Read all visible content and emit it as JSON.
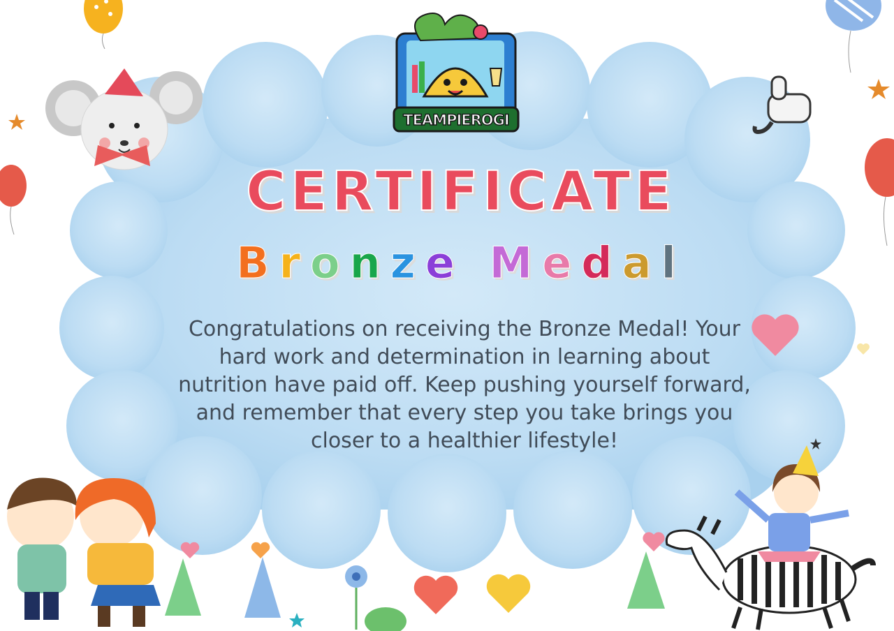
{
  "logo": {
    "text": "TEAMPIEROGI"
  },
  "certificate": {
    "title": "CERTIFICATE",
    "subtitle_letters": [
      "B",
      "r",
      "o",
      "n",
      "z",
      "e",
      " ",
      "M",
      "e",
      "d",
      "a",
      "l"
    ],
    "message": "Congratulations on receiving the Bronze Medal! Your hard work and determination in learning about nutrition have paid off. Keep pushing yourself forward, and remember that every step you take brings you closer to a healthier lifestyle!"
  },
  "colors": {
    "title": "#e94b5d",
    "cloud": "#b9dbf3",
    "text": "#404b57",
    "subtitle": [
      "#f36f1e",
      "#f5b21b",
      "#7ccf8a",
      "#18a64a",
      "#2a93e0",
      "#8b3fd8",
      "#ffffff",
      "#c46ad6",
      "#e87aa9",
      "#d42b5a",
      "#cc9a2e",
      "#5f7380"
    ]
  }
}
